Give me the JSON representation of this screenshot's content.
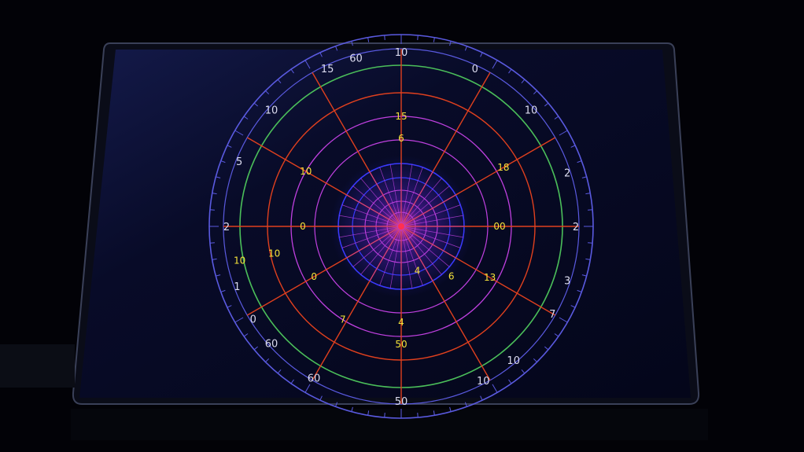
{
  "scene": {
    "description_colors": {
      "background": "#020207",
      "screen": "#070a22",
      "bezel": "#3a4058",
      "outer_ring": "#5a5ae0",
      "green_ring": "#4bbf5a",
      "red_ring": "#e0401e",
      "magenta_ring": "#c040e0",
      "inner_blue": "#3a3aff",
      "spokes": "#e0401e",
      "center": "#ff3050",
      "label_white": "#dcdcf0",
      "label_yellow": "#f4e23a"
    }
  },
  "polar": {
    "outer_labels": [
      "10",
      "0",
      "10",
      "2",
      "2",
      "3",
      "7",
      "10",
      "10",
      "50",
      "60",
      "60",
      "0",
      "1",
      "2",
      "5",
      "10",
      "15",
      "60"
    ],
    "inner_labels": [
      "15",
      "6",
      "10",
      "10",
      "00",
      "18",
      "13",
      "50",
      "4",
      "7",
      "0",
      "10",
      "0",
      "6",
      "4"
    ]
  }
}
